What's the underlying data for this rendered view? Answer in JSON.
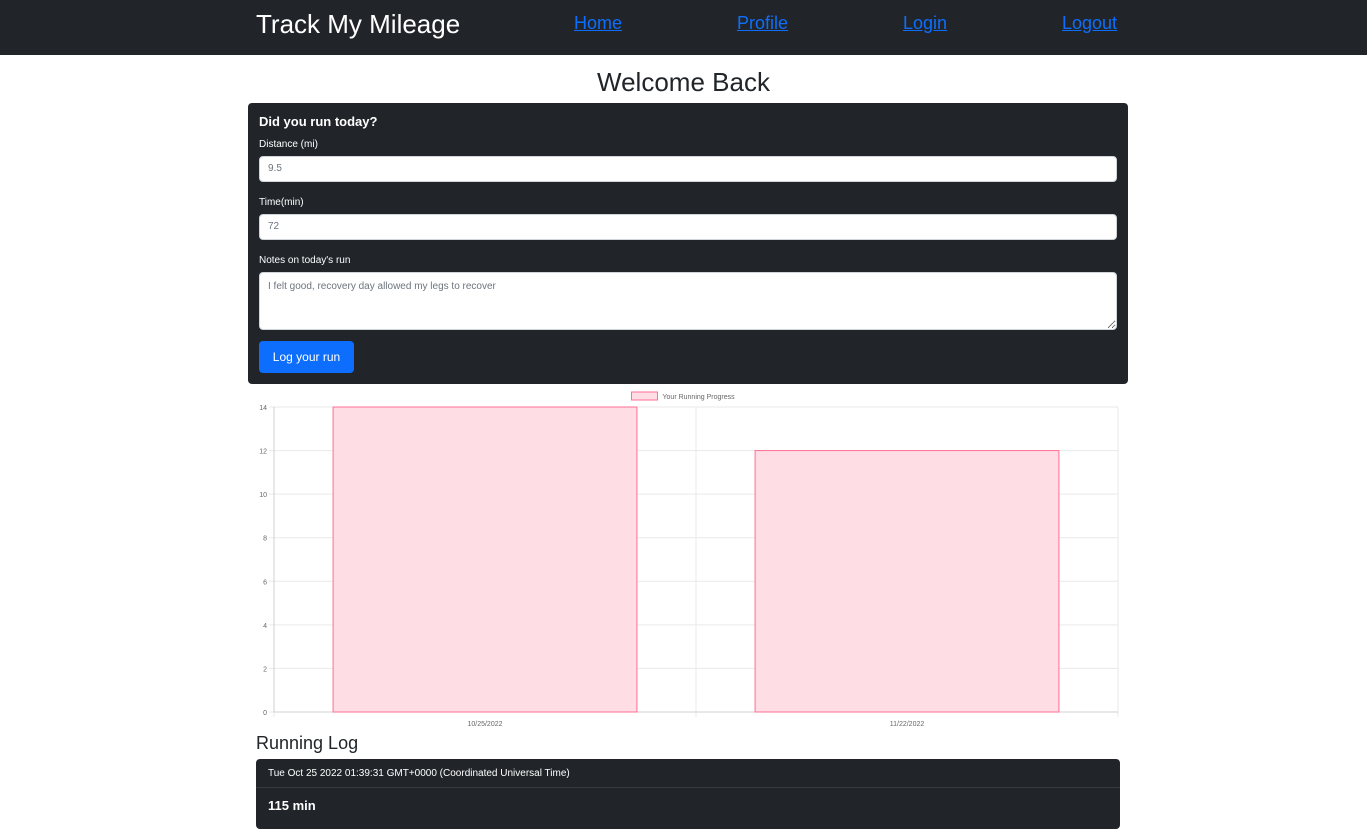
{
  "nav": {
    "brand": "Track My Mileage",
    "links": [
      "Home",
      "Profile",
      "Login",
      "Logout"
    ]
  },
  "page": {
    "title": "Welcome Back"
  },
  "form": {
    "title": "Did you run today?",
    "distance_label": "Distance (mi)",
    "distance_value": "9.5",
    "time_label": "Time(min)",
    "time_value": "72",
    "notes_label": "Notes on today's run",
    "notes_value": "I felt good, recovery day allowed my legs to recover",
    "submit_label": "Log your run"
  },
  "chart_data": {
    "type": "bar",
    "categories": [
      "10/25/2022",
      "11/22/2022"
    ],
    "series": [
      {
        "name": "Your Running Progress",
        "values": [
          14,
          12
        ]
      }
    ],
    "ylim": [
      0,
      14
    ],
    "yticks": [
      0,
      2,
      4,
      6,
      8,
      10,
      12,
      14
    ],
    "grid": true,
    "legend": "top-center",
    "colors": {
      "bar_fill": "#ffdde5",
      "bar_stroke": "#ff6f96",
      "grid": "#e9e9e9",
      "tick_text": "#666666"
    }
  },
  "log": {
    "title": "Running Log",
    "entries": [
      {
        "timestamp": "Tue Oct 25 2022 01:39:31 GMT+0000 (Coordinated Universal Time)",
        "duration": "115 min"
      }
    ]
  }
}
